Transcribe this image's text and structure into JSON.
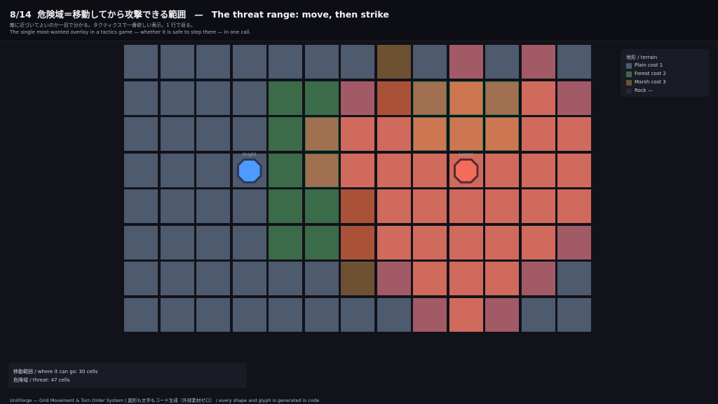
{
  "header": {
    "step": "8/14",
    "title_ja": "危険域＝移動してから攻撃できる範囲",
    "separator": "—",
    "title_en": "The threat range: move, then strike",
    "subtitle_ja": "敵に近づいてよいのか一目で分かる。タクティクスで一番欲しい表示。1 行で返る。",
    "subtitle_en": "The single most-wanted overlay in a tactics game — whether it is safe to step there — in one call."
  },
  "colors": {
    "plain": "#4e5a6e",
    "forest": "#3b6b48",
    "marsh": "#6e5132",
    "rock": "#262835",
    "threat": "#cf6a5c",
    "threat_marsh": "#aa5238",
    "threat_forest": "#a07050",
    "threat_edge": "#a25a66",
    "threat_forest_edge": "#985e60",
    "threat_light": "#cd7752",
    "threat_light_forest": "#9f6a4c",
    "ally": "#4e9bff",
    "enemy": "#f26b5b"
  },
  "grid": {
    "cols": 13,
    "rows": 8,
    "cells": [
      [
        "P",
        "P",
        "P",
        "P",
        "P",
        "P",
        "P",
        "M",
        "P",
        "E",
        "P",
        "E",
        "P"
      ],
      [
        "P",
        "P",
        "P",
        "P",
        "F",
        "F",
        "E",
        "TM",
        "TF",
        "TL",
        "TF",
        "T",
        "E"
      ],
      [
        "P",
        "P",
        "P",
        "P",
        "F",
        "TF",
        "T",
        "T",
        "TL",
        "TL",
        "TL",
        "T",
        "T"
      ],
      [
        "P",
        "P",
        "P",
        "P",
        "F",
        "TF",
        "T",
        "T",
        "T",
        "T",
        "T",
        "T",
        "T"
      ],
      [
        "P",
        "P",
        "P",
        "P",
        "F",
        "F",
        "TM",
        "T",
        "T",
        "T",
        "T",
        "T",
        "T"
      ],
      [
        "P",
        "P",
        "P",
        "P",
        "F",
        "F",
        "TM",
        "T",
        "T",
        "T",
        "T",
        "T",
        "E"
      ],
      [
        "P",
        "P",
        "P",
        "P",
        "P",
        "P",
        "M",
        "E",
        "T",
        "T",
        "T",
        "E",
        "P"
      ],
      [
        "P",
        "P",
        "P",
        "P",
        "P",
        "P",
        "P",
        "P",
        "E",
        "T",
        "E",
        "P",
        "P"
      ]
    ]
  },
  "units": [
    {
      "name": "ally-unit",
      "label": "Knight",
      "col": 3,
      "row": 3,
      "team": "ally"
    },
    {
      "name": "enemy-unit",
      "label": "Lancer",
      "col": 9,
      "row": 3,
      "team": "enemy"
    }
  ],
  "legend": {
    "title": "地形 / terrain",
    "items": [
      {
        "key": "plain",
        "label": "Plain   cost 1"
      },
      {
        "key": "forest",
        "label": "Forest   cost 2"
      },
      {
        "key": "marsh",
        "label": "Marsh   cost 3"
      },
      {
        "key": "rock",
        "label": "Rock   —"
      }
    ]
  },
  "stats": {
    "move_range": "移動範囲 / where it can go: 30 cells",
    "threat": "危険域 / threat: 47 cells"
  },
  "footer": "UnitForge — Grid Movement & Turn Order System   |   図形も文字もコード生成（外部素材ゼロ） / every shape and glyph is generated in code"
}
